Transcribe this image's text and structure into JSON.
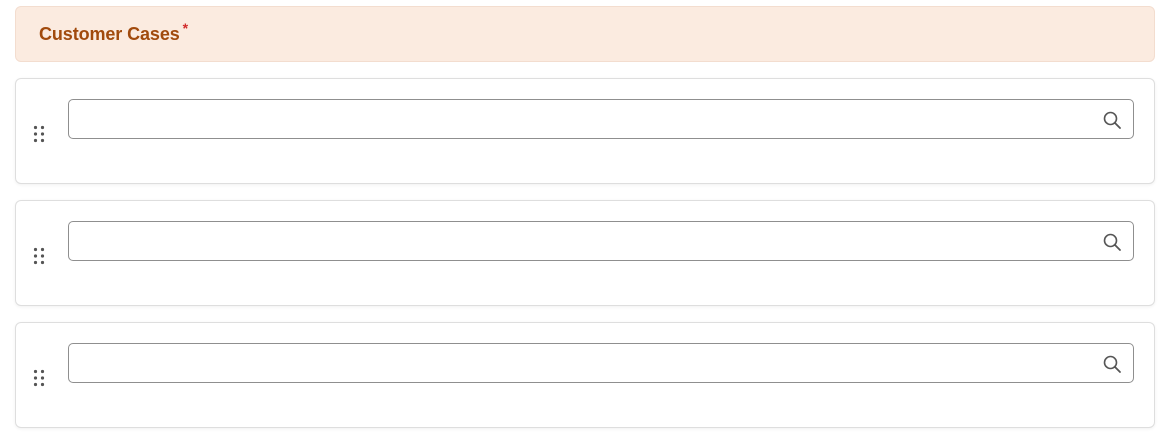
{
  "section": {
    "title": "Customer Cases",
    "required_mark": "*"
  },
  "rows": [
    {
      "search_value": "",
      "search_placeholder": ""
    },
    {
      "search_value": "",
      "search_placeholder": ""
    },
    {
      "search_value": "",
      "search_placeholder": ""
    }
  ],
  "icons": {
    "drag": "drag-handle-icon",
    "search": "search-icon"
  },
  "colors": {
    "header_bg": "#fbebe0",
    "header_text": "#a14a0d",
    "required": "#d12b2b",
    "border": "#dedede",
    "input_border": "#8f8f8f",
    "icon": "#555555"
  }
}
